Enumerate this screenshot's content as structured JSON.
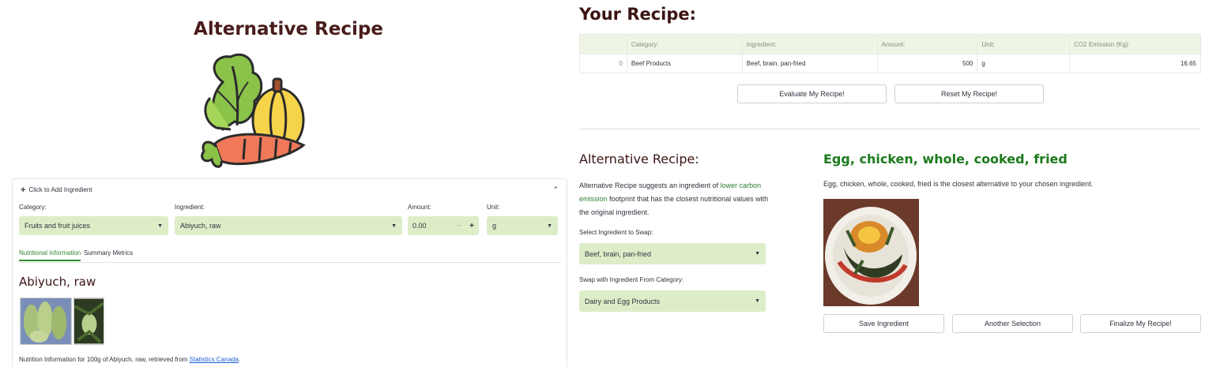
{
  "left": {
    "title": "Alternative Recipe",
    "logo_icon": "vegetables-icon",
    "expander": {
      "header": "Click to Add Ingredient",
      "category_label": "Category:",
      "category_value": "Fruits and fruit juices",
      "ingredient_label": "Ingredient:",
      "ingredient_value": "Abiyuch, raw",
      "amount_label": "Amount:",
      "amount_value": "0.00",
      "amount_minus": "−",
      "amount_plus": "+",
      "unit_label": "Unit:",
      "unit_value": "g",
      "tabs": [
        "Nutritional Information",
        "Summary Metrics"
      ],
      "ingredient_title": "Abiyuch, raw",
      "source_text": "Nutrition Information for 100g of Abiyuch, raw, retrieved from ",
      "source_link": "Statistics Canada",
      "source_end": "."
    }
  },
  "right": {
    "your_recipe_title": "Your Recipe:",
    "table": {
      "headers": [
        "",
        "Category:",
        "Ingredient:",
        "Amount:",
        "Unit:",
        "CO2 Emission (Kg):"
      ],
      "rows": [
        [
          "0",
          "Beef Products",
          "Beef, brain, pan-fried",
          "500",
          "g",
          "16.65"
        ]
      ]
    },
    "evaluate_button": "Evaluate My Recipe!",
    "reset_button": "Reset My Recipe!",
    "alt_title": "Alternative Recipe:",
    "alt_desc_1": "Alternative Recipe suggests an ingredient of ",
    "alt_desc_hl": "lower carbon emission",
    "alt_desc_2": " footprint that has the closest nutritional values with the original ingredient.",
    "swap_label": "Select Ingredient to Swap:",
    "swap_value": "Beef, brain, pan-fried",
    "category_label": "Swap with Ingredient From Category:",
    "category_value": "Dairy and Egg Products",
    "suggestion_title": "Egg, chicken, whole, cooked, fried",
    "suggestion_text": "Egg, chicken, whole, cooked, fried is the closest alternative to your chosen ingredient.",
    "save_button": "Save Ingredient",
    "another_button": "Another Selection",
    "finalize_button": "Finalize My Recipe!"
  },
  "colors": {
    "select_bg": "#dcedc8",
    "accent_green": "#2e8b2e",
    "title_dark": "#3b1414"
  }
}
